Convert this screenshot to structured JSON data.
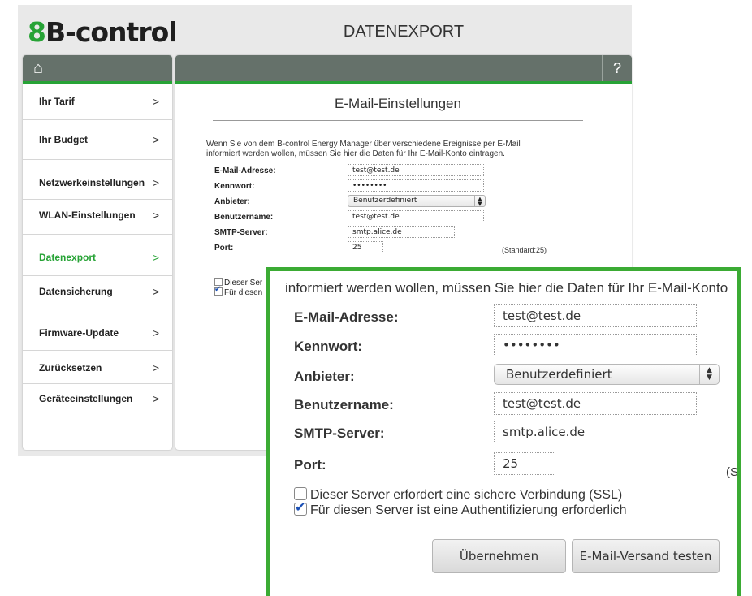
{
  "logo": {
    "prefix": "8",
    "text": "B-control"
  },
  "header": {
    "title": "DATENEXPORT"
  },
  "toolbar": {
    "home_icon": "⌂",
    "help_label": "?"
  },
  "sidebar": {
    "items": [
      {
        "label": "Ihr Tarif"
      },
      {
        "label": "Ihr Budget"
      },
      {
        "label": "Netzwerkeinstellungen"
      },
      {
        "label": "WLAN-Einstellungen"
      },
      {
        "label": "Datenexport",
        "active": true
      },
      {
        "label": "Datensicherung"
      },
      {
        "label": "Firmware-Update"
      },
      {
        "label": "Zurücksetzen"
      },
      {
        "label": "Geräteeinstellungen"
      }
    ],
    "chevron": ">"
  },
  "main": {
    "section_title": "E-Mail-Einstellungen",
    "intro_line1": "Wenn Sie von dem B-control Energy Manager über verschiedene Ereignisse per E-Mail",
    "intro_line2": "informiert werden wollen, müssen Sie hier die Daten für Ihr E-Mail-Konto eintragen.",
    "fields": {
      "email": {
        "label": "E-Mail-Adresse:",
        "value": "test@test.de"
      },
      "password": {
        "label": "Kennwort:",
        "value": "••••••••"
      },
      "provider": {
        "label": "Anbieter:",
        "value": "Benutzerdefiniert"
      },
      "username": {
        "label": "Benutzername:",
        "value": "test@test.de"
      },
      "smtp": {
        "label": "SMTP-Server:",
        "value": "smtp.alice.de"
      },
      "port": {
        "label": "Port:",
        "value": "25"
      }
    },
    "port_standard": "(Standard:25)",
    "checks_small": {
      "ssl": "Dieser Ser",
      "auth": "Für diesen"
    }
  },
  "zoom": {
    "intro": "informiert werden wollen, müssen Sie hier die Daten für Ihr E-Mail-Konto",
    "port_standard_cut": "(S",
    "ssl_label": "Dieser Server erfordert eine sichere Verbindung (SSL)",
    "ssl_checked": false,
    "auth_label": "Für diesen Server ist eine Authentifizierung erforderlich",
    "auth_checked": true,
    "apply_button": "Übernehmen",
    "test_button": "E-Mail-Versand testen"
  },
  "colors": {
    "accent": "#27a336",
    "bar": "#65716a",
    "zoom_border": "#3bab34"
  }
}
